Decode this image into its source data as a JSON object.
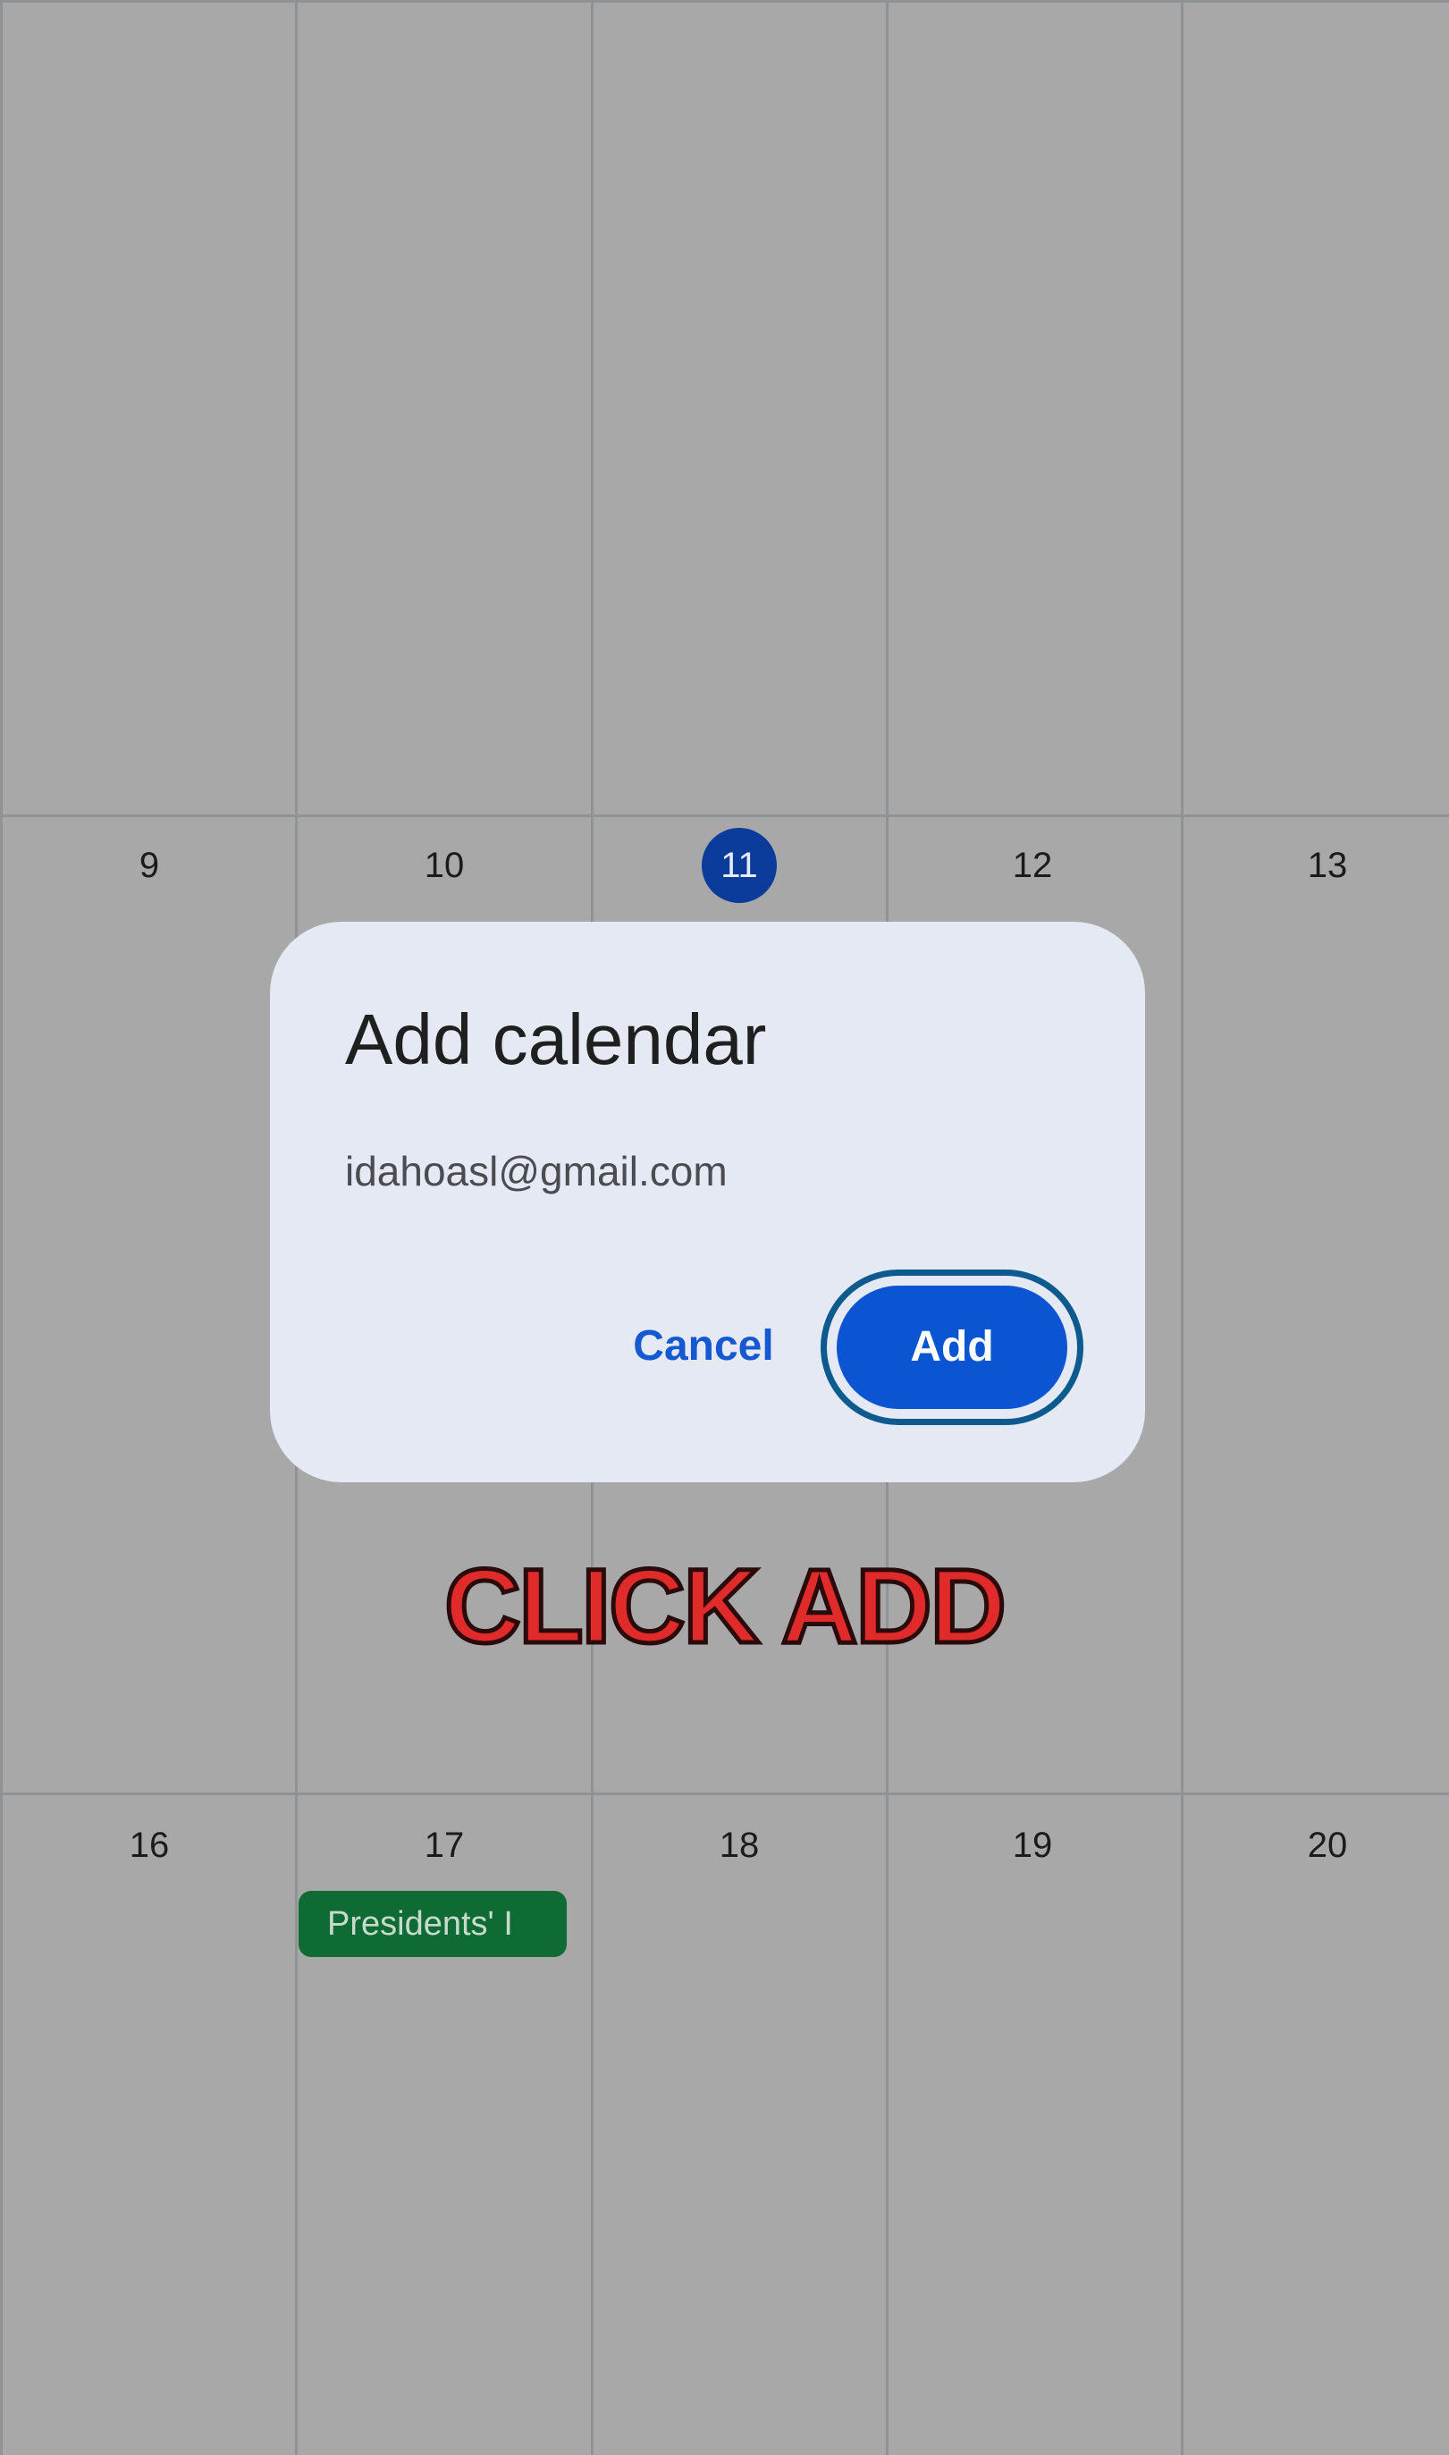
{
  "calendar": {
    "week2": {
      "days": [
        "9",
        "10",
        "11",
        "12",
        "13"
      ],
      "today": "11"
    },
    "week3": {
      "days": [
        "16",
        "17",
        "18",
        "19",
        "20"
      ],
      "event_label": "Presidents' I"
    },
    "colors": {
      "background": "#a8a8a8",
      "today_circle": "#0b3c9c",
      "event_chip": "#0e6b34"
    }
  },
  "dialog": {
    "title": "Add calendar",
    "account": "idahoasl@gmail.com",
    "cancel_label": "Cancel",
    "add_label": "Add",
    "colors": {
      "surface": "#e5e9f4",
      "primary": "#0c55d2"
    }
  },
  "overlay": {
    "instruction": "CLICK ADD",
    "color": "#e12a2a"
  }
}
